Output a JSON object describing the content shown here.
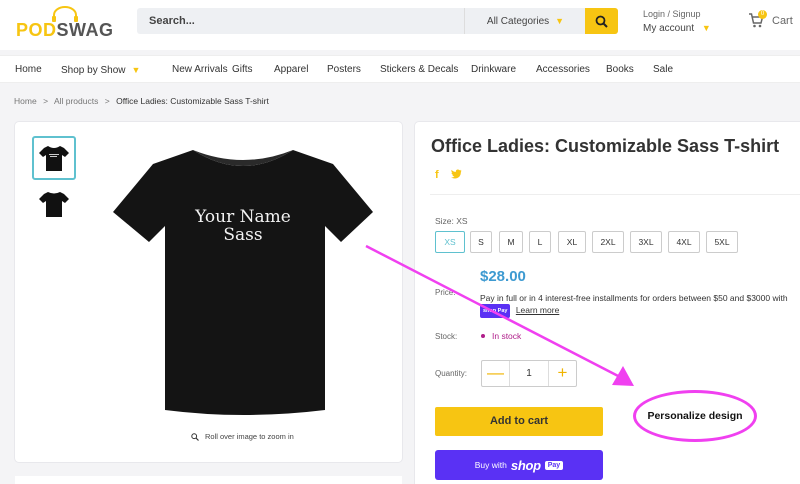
{
  "brand": {
    "pod": "POD",
    "swag": "SWAG",
    "accent": "#f7c512"
  },
  "search": {
    "placeholder": "Search...",
    "category": "All Categories"
  },
  "account": {
    "login": "Login / Signup",
    "my_account": "My account"
  },
  "cart": {
    "label": "Cart",
    "count": "0"
  },
  "nav": [
    "Home",
    "Shop by Show",
    "New Arrivals",
    "Gifts",
    "Apparel",
    "Posters",
    "Stickers & Decals",
    "Drinkware",
    "Accessories",
    "Books",
    "Sale"
  ],
  "breadcrumb": {
    "home": "Home",
    "all": "All products",
    "current": "Office Ladies: Customizable Sass T-shirt",
    "sep": ">"
  },
  "gallery": {
    "shirt_text_line1": "Your Name",
    "shirt_text_line2": "Sass",
    "zoom_hint": "Roll over image to zoom in"
  },
  "product": {
    "title": "Office Ladies: Customizable Sass T-shirt",
    "size_label": "Size: XS",
    "sizes": [
      "XS",
      "S",
      "M",
      "L",
      "XL",
      "2XL",
      "3XL",
      "4XL",
      "5XL"
    ],
    "selected_size": "XS",
    "price_label": "Price:",
    "price": "$28.00",
    "installments": "Pay in full or in 4 interest-free installments for orders between $50 and $3000 with",
    "shoppay_badge": "shop Pay",
    "learn_more": "Learn more",
    "stock_label": "Stock:",
    "stock": "In stock",
    "qty_label": "Quantity:",
    "qty": "1",
    "qty_minus": "—",
    "qty_plus": "+",
    "add_to_cart": "Add to cart",
    "buy_with": "Buy with",
    "shop_word": "shop",
    "pay_word": "Pay"
  },
  "annotation": {
    "label": "Personalize design",
    "color": "#f040f0"
  },
  "colors": {
    "price": "#3d9ad1",
    "stock": "#b01e8a",
    "shoppay": "#5a31f4",
    "selected": "#5fc1cf"
  }
}
